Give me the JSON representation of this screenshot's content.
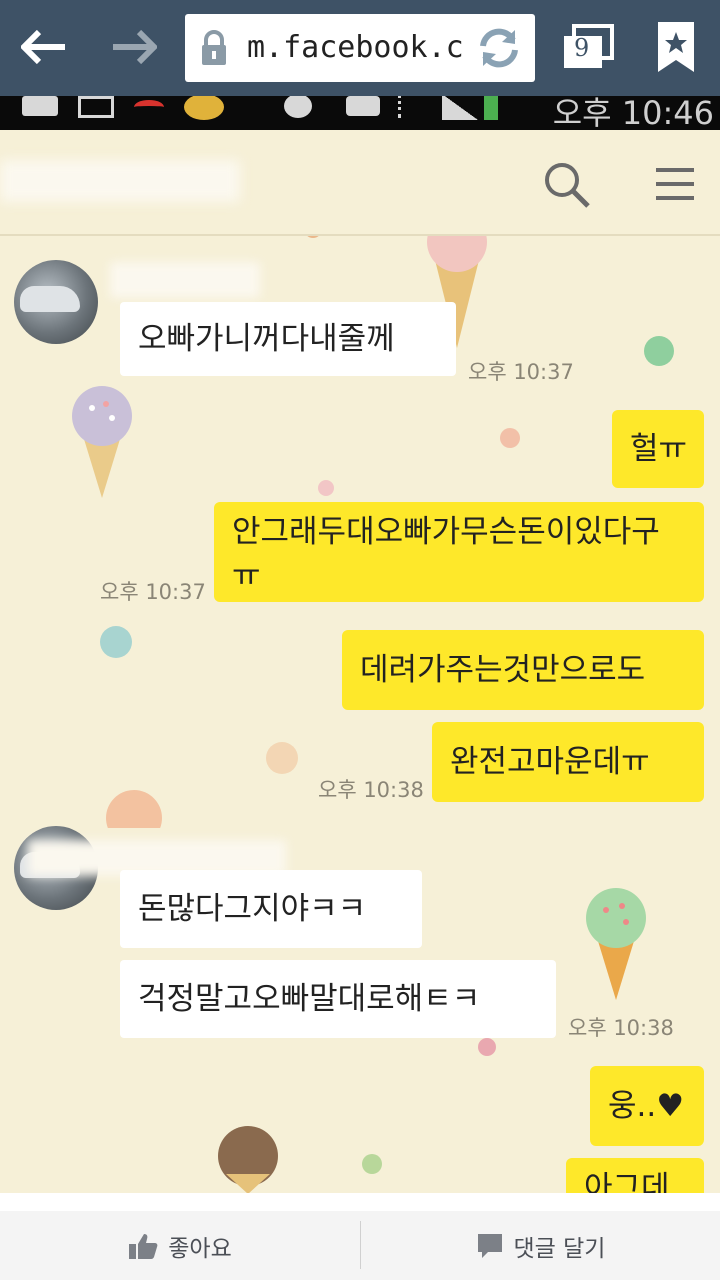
{
  "browser": {
    "url": "m.facebook.c",
    "tab_count": "9",
    "icons": [
      "back-arrow-icon",
      "forward-arrow-icon",
      "lock-icon",
      "refresh-icon",
      "tabs-icon",
      "bookmark-icon"
    ]
  },
  "status_bar": {
    "time": "오후 10:46"
  },
  "chat": {
    "messages": [
      {
        "side": "left",
        "text": "오빠가니꺼다내줄께",
        "time": "오후 10:37"
      },
      {
        "side": "right",
        "text": "헐ㅠ"
      },
      {
        "side": "right",
        "text": "안그래두대오빠가무슨돈이있다구ㅠ",
        "time": "오후 10:37"
      },
      {
        "side": "right",
        "text": "데려가주는것만으로도"
      },
      {
        "side": "right",
        "text": "완전고마운데ㅠ",
        "time": "오후 10:38"
      },
      {
        "side": "left",
        "text": "돈많다그지야ㅋㅋ"
      },
      {
        "side": "left",
        "text": "걱정말고오빠말대로해ㅌㅋ",
        "time": "오후 10:38"
      },
      {
        "side": "right",
        "text": "웅..♥"
      },
      {
        "side": "right",
        "text": "아그데"
      }
    ]
  },
  "actions": {
    "like_label": "좋아요",
    "comment_label": "댓글 달기"
  },
  "colors": {
    "browser_bar": "#3e5266",
    "chat_background": "#f6f0d7",
    "my_bubble": "#fee82a",
    "their_bubble": "#ffffff"
  }
}
